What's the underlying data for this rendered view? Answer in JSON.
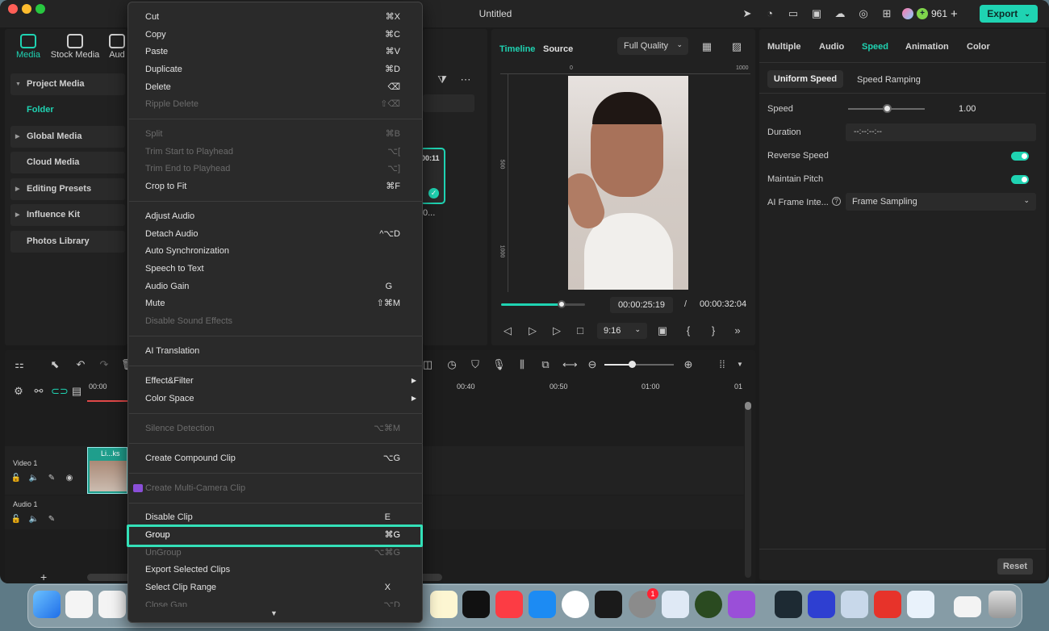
{
  "window": {
    "title": "Untitled"
  },
  "topbar": {
    "credits": "961",
    "export_label": "Export"
  },
  "left_panel": {
    "tabs": [
      "Media",
      "Stock Media",
      "Aud"
    ],
    "items": [
      "Project Media",
      "Folder",
      "Global Media",
      "Cloud Media",
      "Editing Presets",
      "Influence Kit",
      "Photos Library"
    ]
  },
  "media_thumb": {
    "duration": "00:11",
    "caption": "0..."
  },
  "context_menu": {
    "items": [
      {
        "label": "Cut",
        "shortcut": "⌘X"
      },
      {
        "label": "Copy",
        "shortcut": "⌘C"
      },
      {
        "label": "Paste",
        "shortcut": "⌘V"
      },
      {
        "label": "Duplicate",
        "shortcut": "⌘D"
      },
      {
        "label": "Delete",
        "shortcut": "⌫"
      },
      {
        "label": "Ripple Delete",
        "shortcut": "⇧⌫"
      },
      {
        "label": "Split",
        "shortcut": "⌘B"
      },
      {
        "label": "Trim Start to Playhead",
        "shortcut": "⌥["
      },
      {
        "label": "Trim End to Playhead",
        "shortcut": "⌥]"
      },
      {
        "label": "Crop to Fit",
        "shortcut": "⌘F"
      },
      {
        "label": "Adjust Audio",
        "shortcut": ""
      },
      {
        "label": "Detach Audio",
        "shortcut": "^⌥D"
      },
      {
        "label": "Auto Synchronization",
        "shortcut": ""
      },
      {
        "label": "Speech to Text",
        "shortcut": ""
      },
      {
        "label": "Audio Gain",
        "shortcut": "G"
      },
      {
        "label": "Mute",
        "shortcut": "⇧⌘M"
      },
      {
        "label": "Disable Sound Effects",
        "shortcut": ""
      },
      {
        "label": "AI Translation",
        "shortcut": ""
      },
      {
        "label": "Effect&Filter",
        "shortcut": ""
      },
      {
        "label": "Color Space",
        "shortcut": ""
      },
      {
        "label": "Silence Detection",
        "shortcut": "⌥⌘M"
      },
      {
        "label": "Create Compound Clip",
        "shortcut": "⌥G"
      },
      {
        "label": "Create Multi-Camera Clip",
        "shortcut": ""
      },
      {
        "label": "Disable Clip",
        "shortcut": "E"
      },
      {
        "label": "Group",
        "shortcut": "⌘G"
      },
      {
        "label": "UnGroup",
        "shortcut": "⌥⌘G"
      },
      {
        "label": "Export Selected Clips",
        "shortcut": ""
      },
      {
        "label": "Select Clip Range",
        "shortcut": "X"
      },
      {
        "label": "Close Gap",
        "shortcut": "⌥D"
      }
    ]
  },
  "preview": {
    "tabs": [
      "Timeline",
      "Source"
    ],
    "quality": "Full Quality",
    "ruler": [
      "0",
      "1000",
      "500",
      "1000"
    ],
    "current_time": "00:00:25:19",
    "separator": "/",
    "total_time": "00:00:32:04",
    "aspect": "9:16",
    "progress": 0.72
  },
  "properties": {
    "tabs": [
      "Multiple",
      "Audio",
      "Speed",
      "Animation",
      "Color"
    ],
    "subtabs": [
      "Uniform Speed",
      "Speed Ramping"
    ],
    "speed_label": "Speed",
    "speed_value": "1.00",
    "speed_level": 0.5,
    "duration_label": "Duration",
    "duration_value": "--:--:--:--",
    "reverse_label": "Reverse Speed",
    "pitch_label": "Maintain Pitch",
    "ai_label": "AI Frame Inte...",
    "ai_value": "Frame Sampling",
    "reset_label": "Reset"
  },
  "timeline": {
    "ruler": [
      "00:00",
      "00:40",
      "00:50",
      "01:00",
      "01"
    ],
    "tracks": [
      "Video 1",
      "Audio 1"
    ],
    "clip_label": "Li...ks",
    "plus": "+"
  },
  "dock": {
    "badge": "1"
  }
}
